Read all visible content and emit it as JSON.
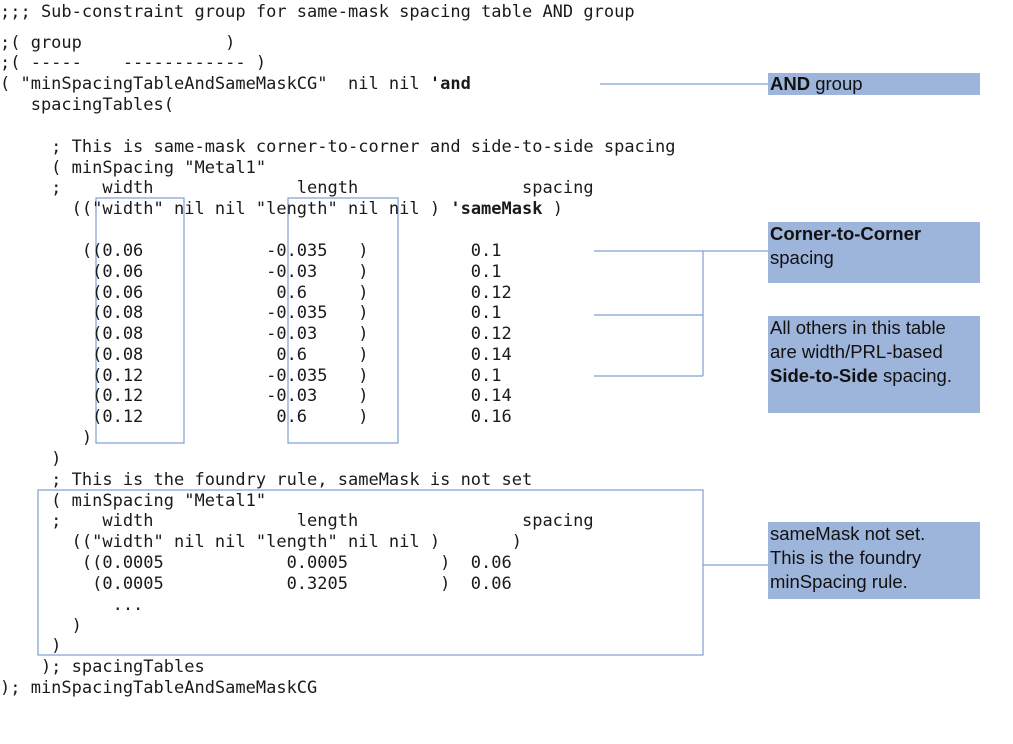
{
  "code": {
    "l01": ";;; Sub-constraint group for same-mask spacing table AND group",
    "l02": ";( group              )",
    "l03": ";( -----    ------------ )",
    "l04_a": "( \"minSpacingTableAndSameMaskCG\"  nil nil ",
    "l04_b": "'and",
    "l05": "   spacingTables(",
    "l06": "     ; This is same-mask corner-to-corner and side-to-side spacing",
    "l07": "     ( minSpacing \"Metal1\"",
    "l08": "     ;    width              length                spacing",
    "l09_a": "       ((\"width\" nil nil \"length\" nil nil ) ",
    "l09_b": "'sameMask",
    "l09_c": " )",
    "rows": [
      "        ((0.06            -0.035   )          0.1",
      "         (0.06            -0.03    )          0.1",
      "         (0.06             0.6     )          0.12",
      "         (0.08            -0.035   )          0.1",
      "         (0.08            -0.03    )          0.12",
      "         (0.08             0.6     )          0.14",
      "         (0.12            -0.035   )          0.1",
      "         (0.12            -0.03    )          0.14",
      "         (0.12             0.6     )          0.16"
    ],
    "l19": "        )",
    "l20": "     )",
    "l21": "     ; This is the foundry rule, sameMask is not set",
    "l22": "     ( minSpacing \"Metal1\"",
    "l23": "     ;    width              length                spacing",
    "l24": "       ((\"width\" nil nil \"length\" nil nil )       )",
    "l25": "        ((0.0005            0.0005         )  0.06",
    "l26": "         (0.0005            0.3205         )  0.06",
    "l27": "           ...",
    "l28": "       )",
    "l29": "     )",
    "l30": "    ); spacingTables",
    "l31": "); minSpacingTableAndSameMaskCG"
  },
  "callouts": {
    "and_group": {
      "bold": "AND",
      "rest": " group"
    },
    "corner": {
      "bold": "Corner-to-Corner",
      "line2": "spacing"
    },
    "side": {
      "line1": "All others in this table",
      "line2": "are width/PRL-based",
      "bold": "Side-to-Side",
      "rest": " spacing."
    },
    "foundry": {
      "line1": "sameMask not set.",
      "line2": "This is the foundry",
      "line3": "minSpacing rule."
    }
  },
  "colors": {
    "callout_bg": "#9db4db",
    "line": "#7f9fd0"
  }
}
